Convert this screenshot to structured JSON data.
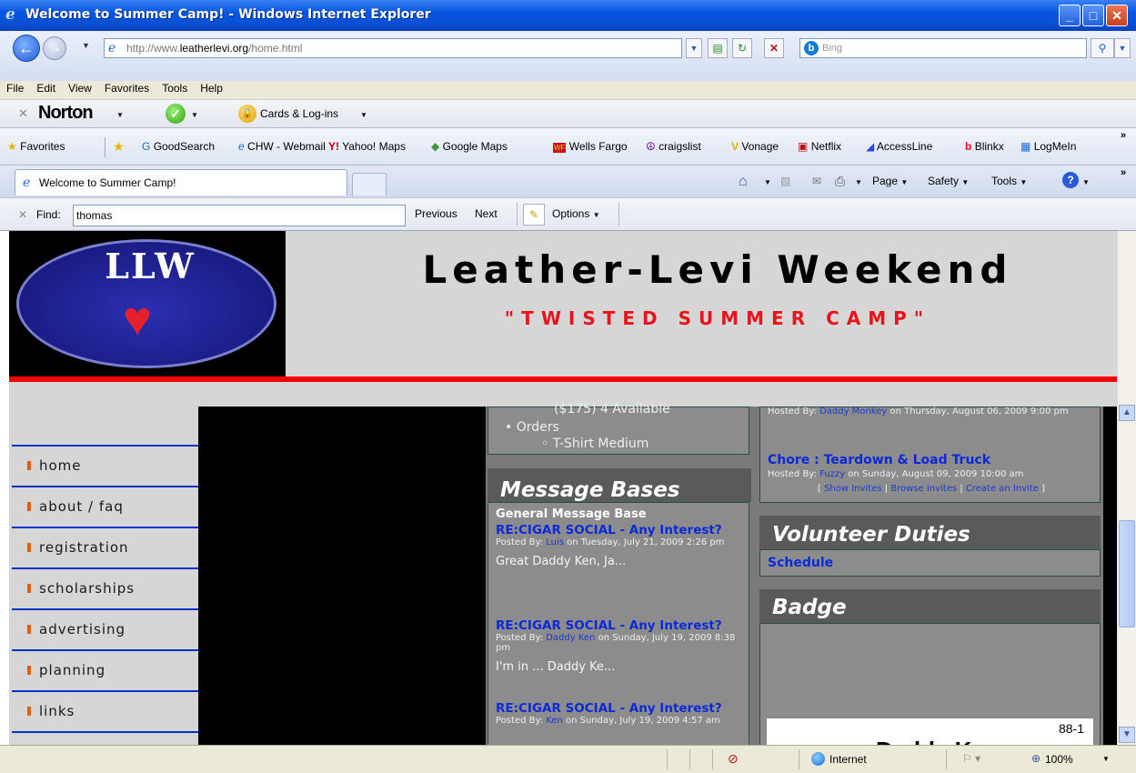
{
  "window": {
    "title": "Welcome to Summer Camp! - Windows Internet Explorer"
  },
  "address": {
    "url_prefix": "http://www.",
    "url_domain": "leatherlevi.org",
    "url_path": "/home.html",
    "search_placeholder": "Bing"
  },
  "menu": [
    "File",
    "Edit",
    "View",
    "Favorites",
    "Tools",
    "Help"
  ],
  "norton": {
    "brand": "Norton",
    "cards": "Cards & Log-ins"
  },
  "favorites": {
    "label": "Favorites",
    "items": [
      "GoodSearch",
      "CHW - Webmail",
      "Yahoo! Maps",
      "Google Maps",
      "Wells Fargo",
      "craigslist",
      "Vonage",
      "Netflix",
      "AccessLine",
      "Blinkx",
      "LogMeIn"
    ]
  },
  "tab": {
    "title": "Welcome to Summer Camp!"
  },
  "commandbar": {
    "page": "Page",
    "safety": "Safety",
    "tools": "Tools"
  },
  "find": {
    "label": "Find:",
    "value": "thomas",
    "previous": "Previous",
    "next": "Next",
    "options": "Options"
  },
  "site": {
    "logo_text": "LLW",
    "title": "Leather-Levi Weekend",
    "subtitle": "\"TWISTED SUMMER CAMP\"",
    "nav": [
      "home",
      "about / faq",
      "registration",
      "scholarships",
      "advertising",
      "planning",
      "links"
    ]
  },
  "store": {
    "available": "($175) 4 Available",
    "orders": "Orders",
    "order_item": "T-Shirt Medium"
  },
  "messages": {
    "header": "Message Bases",
    "base": "General Message Base",
    "posts": [
      {
        "title": "RE:CIGAR SOCIAL - Any Interest?",
        "posted_by": "Posted By:",
        "author": "Luis",
        "date": "on Tuesday, July 21, 2009 2:26 pm",
        "excerpt": "Great Daddy Ken, Ja..."
      },
      {
        "title": "RE:CIGAR SOCIAL - Any Interest?",
        "posted_by": "Posted By:",
        "author": "Daddy Ken",
        "date": "on Sunday, July 19, 2009 8:38 pm",
        "excerpt": "I'm in ... Daddy Ke..."
      },
      {
        "title": "RE:CIGAR SOCIAL - Any Interest?",
        "posted_by": "Posted By:",
        "author": "Ken",
        "date": "on Sunday, July 19, 2009 4:57 am",
        "excerpt": ""
      }
    ]
  },
  "events": {
    "hosted_by": "Hosted By:",
    "event1_host": "Daddy Monkey",
    "event1_date": "on Thursday, August 06, 2009 9:00 pm",
    "event2_title": "Chore : Teardown & Load Truck",
    "event2_host": "Fuzzy",
    "event2_date": "on Sunday, August 09, 2009 10:00 am",
    "show_invites": "Show Invites",
    "browse_invites": "Browse Invites",
    "create_invite": "Create an Invite"
  },
  "volunteer": {
    "header": "Volunteer Duties",
    "schedule": "Schedule"
  },
  "badge": {
    "header": "Badge",
    "number": "88-1",
    "name_partial": "Daddy K"
  },
  "status": {
    "zone": "Internet",
    "zoom": "100%"
  }
}
